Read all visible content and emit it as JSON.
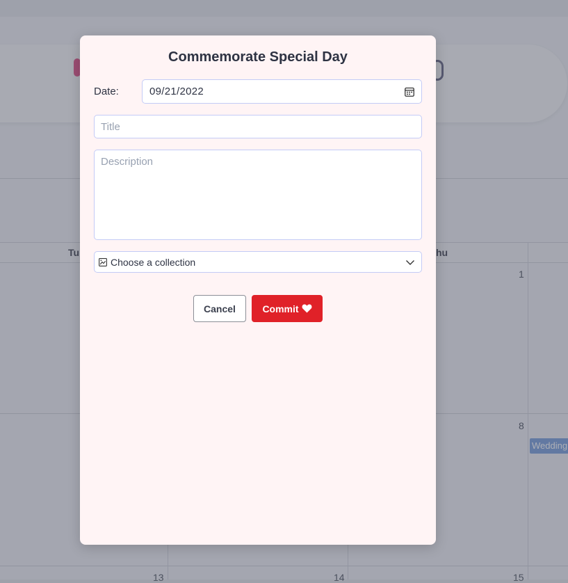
{
  "background": {
    "day_headers": [
      "Tu",
      "hu"
    ],
    "day_numbers": [
      "1",
      "8",
      "13",
      "14",
      "15"
    ],
    "event_label": "Wedding"
  },
  "modal": {
    "title": "Commemorate Special Day",
    "date_label": "Date:",
    "date_value": "09/21/2022",
    "title_placeholder": "Title",
    "description_placeholder": "Description",
    "collection_placeholder": "Choose a collection",
    "cancel_label": "Cancel",
    "commit_label": "Commit"
  },
  "icons": {
    "date": "calendar-icon",
    "collection": "collection-icon",
    "dropdown": "chevron-down-icon",
    "commit": "heart-icon"
  },
  "colors": {
    "modal_bg": "#fff4f5",
    "field_border": "#c3cbf6",
    "commit_button": "#e02128",
    "event": "#7ea3dd"
  }
}
